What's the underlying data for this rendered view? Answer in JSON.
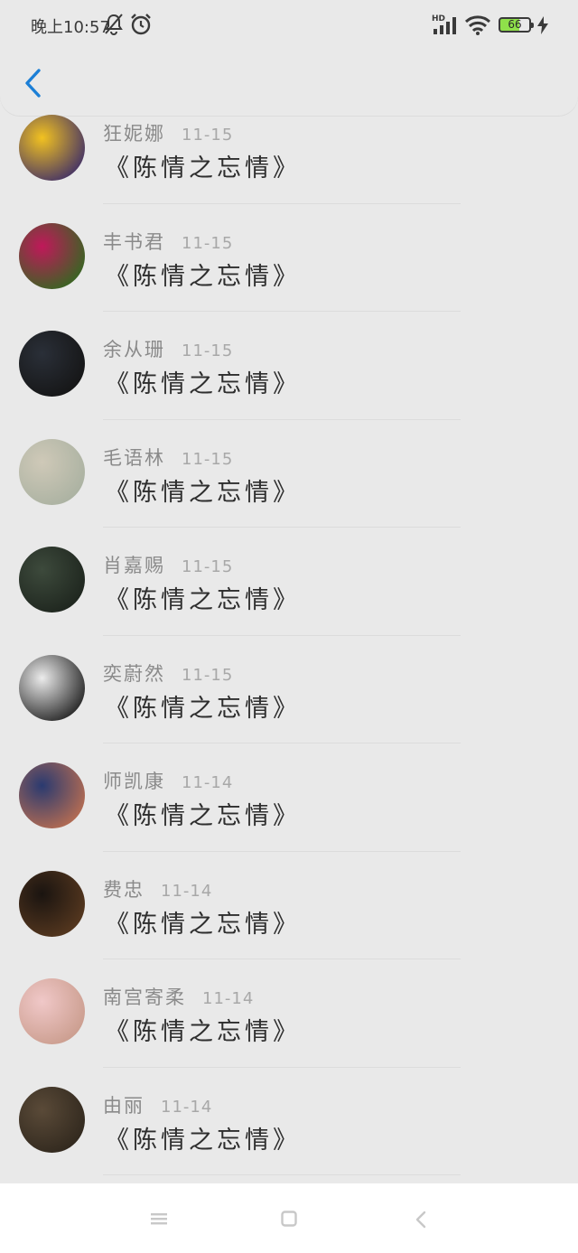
{
  "status_bar": {
    "time": "晚上10:57",
    "network_label": "HD",
    "battery": "66"
  },
  "header": {
    "back_icon": "chevron-left-icon",
    "accent_color": "#1c7fd6"
  },
  "comments": [
    {
      "name": "狂妮娜",
      "date": "11-15",
      "message": "《陈情之忘情》",
      "avatar_colors": [
        "#f2c220",
        "#3a2a6a"
      ]
    },
    {
      "name": "丰书君",
      "date": "11-15",
      "message": "《陈情之忘情》",
      "avatar_colors": [
        "#c0185a",
        "#2e6b1e"
      ]
    },
    {
      "name": "余从珊",
      "date": "11-15",
      "message": "《陈情之忘情》",
      "avatar_colors": [
        "#2a2f38",
        "#141414"
      ]
    },
    {
      "name": "毛语林",
      "date": "11-15",
      "message": "《陈情之忘情》",
      "avatar_colors": [
        "#cfc9b8",
        "#a8b0a0"
      ]
    },
    {
      "name": "肖嘉赐",
      "date": "11-15",
      "message": "《陈情之忘情》",
      "avatar_colors": [
        "#3d4a3c",
        "#1c231c"
      ]
    },
    {
      "name": "奕蔚然",
      "date": "11-15",
      "message": "《陈情之忘情》",
      "avatar_colors": [
        "#ececec",
        "#1a1a1a"
      ]
    },
    {
      "name": "师凯康",
      "date": "11-14",
      "message": "《陈情之忘情》",
      "avatar_colors": [
        "#2a3a70",
        "#c07050"
      ]
    },
    {
      "name": "费忠",
      "date": "11-14",
      "message": "《陈情之忘情》",
      "avatar_colors": [
        "#1a1410",
        "#5a3a20"
      ]
    },
    {
      "name": "南宫寄柔",
      "date": "11-14",
      "message": "《陈情之忘情》",
      "avatar_colors": [
        "#f0c8c8",
        "#c89a8a"
      ]
    },
    {
      "name": "由丽",
      "date": "11-14",
      "message": "《陈情之忘情》",
      "avatar_colors": [
        "#5a4a38",
        "#2e261c"
      ]
    }
  ],
  "nav_bar": {
    "menu_icon": "menu-icon",
    "home_icon": "home-square-icon",
    "back_icon": "back-chevron-icon"
  }
}
